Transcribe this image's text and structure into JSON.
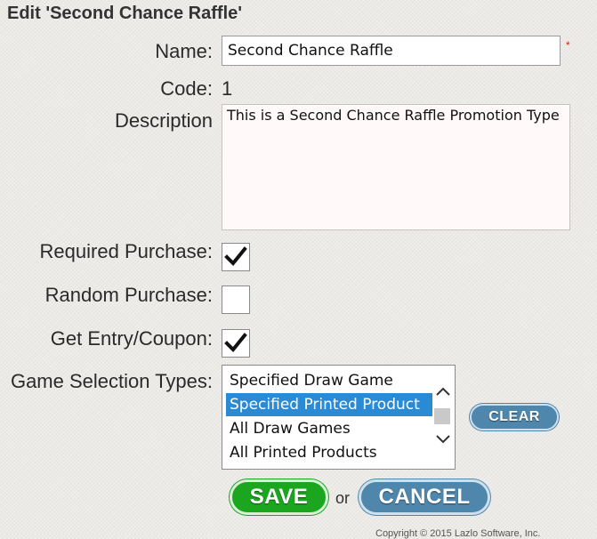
{
  "page": {
    "title": "Edit 'Second Chance Raffle'"
  },
  "form": {
    "name_label": "Name:",
    "name_value": "Second Chance Raffle",
    "required_marker": "*",
    "code_label": "Code:",
    "code_value": "1",
    "description_label": "Description",
    "description_value": "This is a Second Chance Raffle Promotion Type",
    "required_purchase_label": "Required Purchase:",
    "required_purchase_checked": true,
    "random_purchase_label": "Random Purchase:",
    "random_purchase_checked": false,
    "get_entry_label": "Get Entry/Coupon:",
    "get_entry_checked": true,
    "game_selection_label": "Game Selection Types:",
    "game_selection_options": [
      {
        "label": "Specified Draw Game",
        "selected": false
      },
      {
        "label": "Specified Printed Product",
        "selected": true
      },
      {
        "label": "All Draw Games",
        "selected": false
      },
      {
        "label": "All Printed Products",
        "selected": false
      }
    ]
  },
  "buttons": {
    "clear": "CLEAR",
    "save": "SAVE",
    "or": "or",
    "cancel": "CANCEL"
  },
  "footer": {
    "text": "Copyright © 2015 Lazlo Software, Inc."
  },
  "colors": {
    "save_green": "#1ca51f",
    "blue_button": "#4f86ac",
    "selection_blue": "#2a8ad4",
    "required_red": "#cc2a00"
  },
  "icons": {
    "checkmark": "check-icon",
    "scroll_up": "chevron-up-icon",
    "scroll_down": "chevron-down-icon"
  }
}
